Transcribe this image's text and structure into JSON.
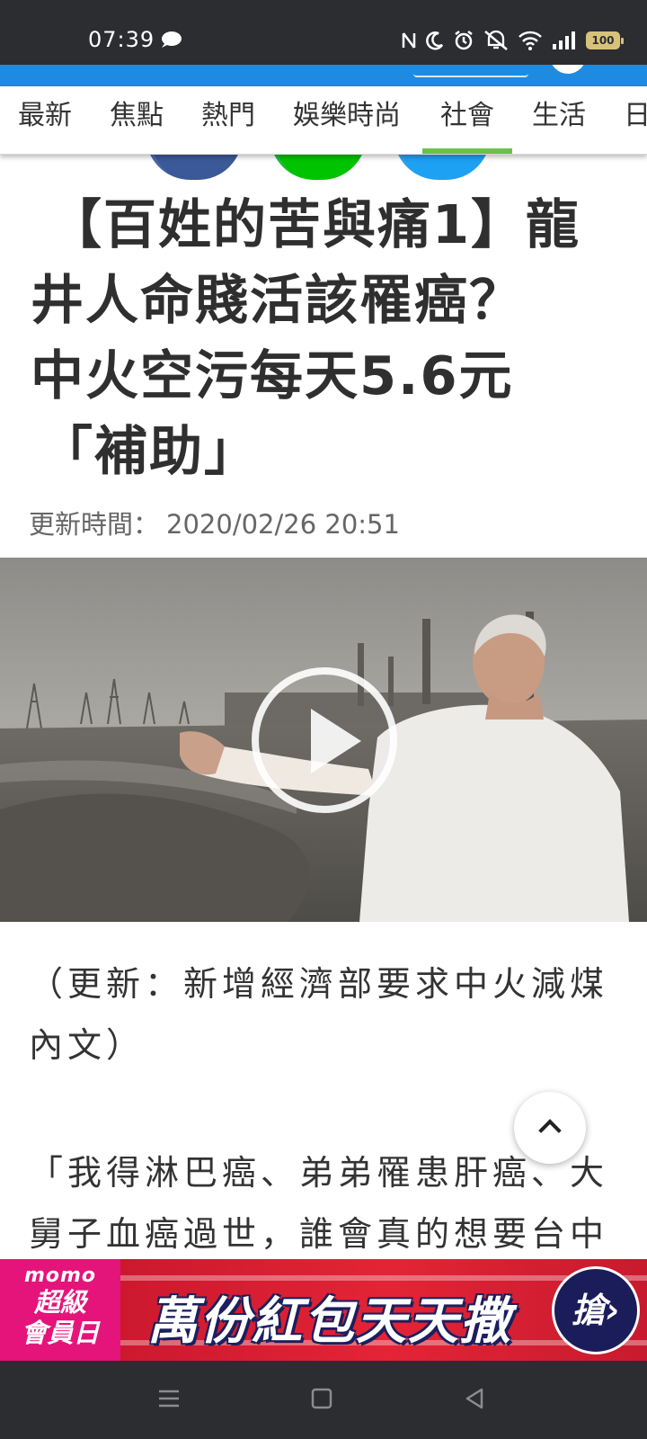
{
  "status_bar": {
    "time": "07:39",
    "battery": "100",
    "icons": [
      "chat-icon",
      "nfc-icon",
      "moon-icon",
      "alarm-icon",
      "mute-icon",
      "wifi-icon",
      "signal-icon",
      "battery-icon"
    ]
  },
  "nav": {
    "tabs": [
      {
        "label": "最新",
        "active": false
      },
      {
        "label": "焦點",
        "active": false
      },
      {
        "label": "熱門",
        "active": false
      },
      {
        "label": "娛樂時尚",
        "active": false
      },
      {
        "label": "社會",
        "active": true
      },
      {
        "label": "生活",
        "active": false
      },
      {
        "label": "日",
        "active": false
      }
    ],
    "active_color": "#6cc04a"
  },
  "share": [
    "facebook-icon",
    "line-icon",
    "twitter-icon"
  ],
  "article": {
    "headline_lines": [
      "【百姓的苦與痛1】龍",
      "井人命賤活該罹癌？",
      "中火空污每天5.6元",
      "「補助」"
    ],
    "update_label": "更新時間：",
    "update_time": "2020/02/26 20:51",
    "para1": "（更新：新增經濟部要求中火減煤內文）",
    "para2": "「我得淋巴癌、弟弟罹患肝癌、大舅子血癌過世，誰會真的想要台中"
  },
  "ad": {
    "brand": "momo",
    "sub_line1": "超級",
    "sub_line2": "會員日",
    "text": "萬份紅包天天撒",
    "cta": "搶"
  },
  "colors": {
    "header_blue": "#1e8be0",
    "ad_red": "#e32436",
    "ad_pink": "#e4147a",
    "system_bar": "#2b2d31"
  }
}
